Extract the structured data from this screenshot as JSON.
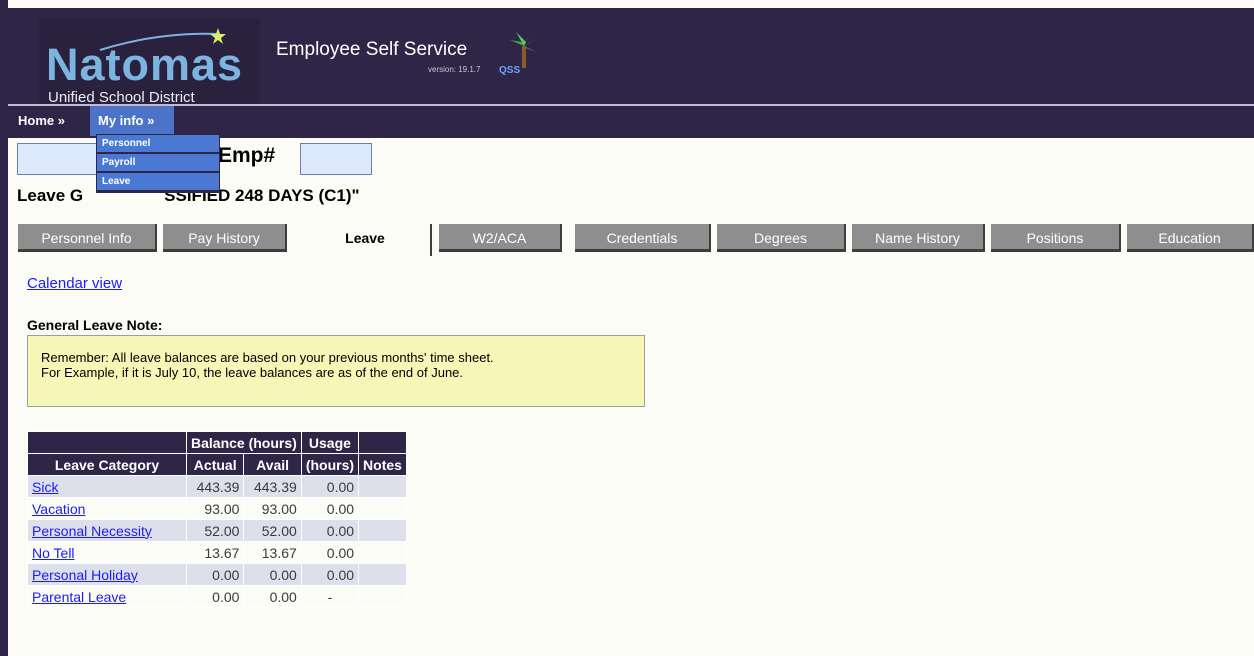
{
  "header": {
    "logo_main": "Natomas",
    "logo_sub": "Unified School District",
    "app_title": "Employee Self Service",
    "version": "version: 19.1.7",
    "vendor": "QSS"
  },
  "nav": {
    "home": "Home »",
    "myinfo": "My info »",
    "dropdown": [
      "Personnel",
      "Payroll",
      "Leave"
    ]
  },
  "employee": {
    "emp_label": "Emp#",
    "leave_group_prefix": "Leave G",
    "leave_group_suffix": "SSIFIED 248 DAYS (C1)\""
  },
  "tabs": [
    "Personnel Info",
    "Pay History",
    "Leave",
    "W2/ACA",
    "Credentials",
    "Degrees",
    "Name History",
    "Positions",
    "Education"
  ],
  "active_tab": "Leave",
  "calendar_link": "Calendar view",
  "note": {
    "label": "General Leave Note:",
    "line1": "Remember: All leave balances are based on your previous months' time sheet.",
    "line2": "For Example, if it is July 10, the leave balances are as of the end of June."
  },
  "table": {
    "header_top": {
      "balance": "Balance (hours)",
      "usage": "Usage"
    },
    "header_sub": {
      "category": "Leave Category",
      "actual": "Actual",
      "avail": "Avail",
      "usage": "(hours)",
      "notes": "Notes"
    },
    "rows": [
      {
        "category": "Sick",
        "actual": "443.39",
        "avail": "443.39",
        "usage": "0.00"
      },
      {
        "category": "Vacation",
        "actual": "93.00",
        "avail": "93.00",
        "usage": "0.00"
      },
      {
        "category": "Personal Necessity",
        "actual": "52.00",
        "avail": "52.00",
        "usage": "0.00"
      },
      {
        "category": "No Tell",
        "actual": "13.67",
        "avail": "13.67",
        "usage": "0.00"
      },
      {
        "category": "Personal Holiday",
        "actual": "0.00",
        "avail": "0.00",
        "usage": "0.00"
      },
      {
        "category": "Parental Leave",
        "actual": "0.00",
        "avail": "0.00",
        "usage": "-"
      }
    ]
  }
}
